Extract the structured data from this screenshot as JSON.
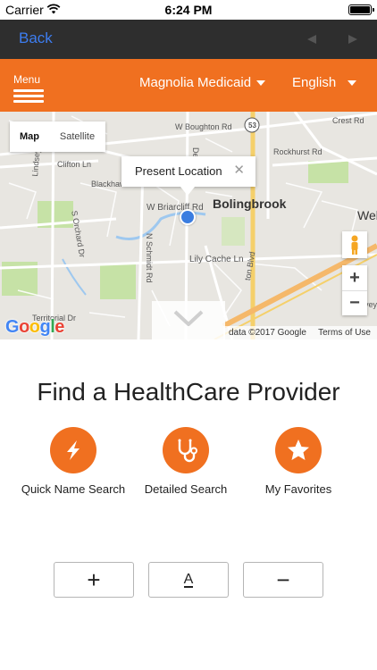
{
  "status_bar": {
    "carrier": "Carrier",
    "time": "6:24 PM",
    "battery_level": 1.0
  },
  "nav": {
    "back_label": "Back"
  },
  "header": {
    "menu_label": "Menu",
    "plan_selected": "Magnolia Medicaid",
    "language_selected": "English",
    "accent_color": "#f07020"
  },
  "map": {
    "type_tabs": [
      "Map",
      "Satellite"
    ],
    "active_tab": "Map",
    "callout": "Present Location",
    "callout_close": "✕",
    "labels": {
      "w_boughton": "W Boughton Rd",
      "rockhurst": "Rockhurst Rd",
      "crest": "Crest Rd",
      "route": "53",
      "clifton": "Clifton Ln",
      "blackhawk": "Blackhaw",
      "lindsey": "Lindsey Ln",
      "w_briarcliff": "W Briarcliff Rd",
      "bolingbrook": "Bolingbrook",
      "wel": "Wel",
      "orchard": "S Orchard Dr",
      "schmidt": "N Schmidt Rd",
      "lily_cache": "Lily Cache Ln",
      "territorial": "Territorial Dr",
      "ton_blvd": "ton Blvd",
      "dela": "Dela",
      "vey": "vey"
    },
    "google_letters": [
      "G",
      "o",
      "o",
      "g",
      "l",
      "e"
    ],
    "google_colors": [
      "#4285f4",
      "#ea4335",
      "#fbbc05",
      "#4285f4",
      "#34a853",
      "#ea4335"
    ],
    "copyright": "data ©2017 Google",
    "terms": "Terms of Use",
    "zoom_in": "+",
    "zoom_out": "−"
  },
  "main": {
    "title": "Find a HealthCare Provider",
    "actions": [
      {
        "label": "Quick Name Search",
        "icon": "lightning-icon"
      },
      {
        "label": "Detailed Search",
        "icon": "stethoscope-icon"
      },
      {
        "label": "My Favorites",
        "icon": "star-icon"
      }
    ]
  },
  "font_controls": {
    "increase": "+",
    "reset": "A",
    "decrease": "−"
  }
}
